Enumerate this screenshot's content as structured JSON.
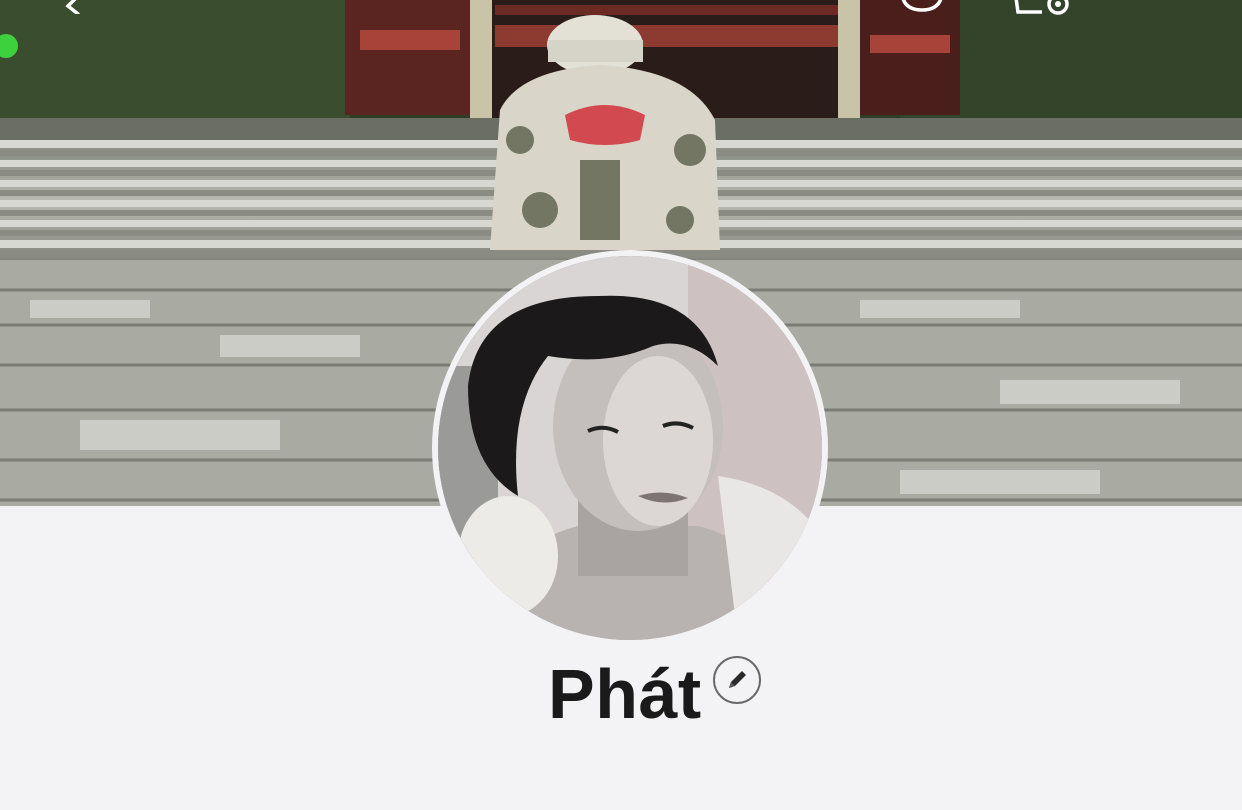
{
  "profile": {
    "name": "Phát",
    "cover_image": "cover-photo",
    "avatar_image": "profile-photo"
  },
  "icons": {
    "back": "back-chevron-icon",
    "chat": "chat-bubble-icon",
    "user_settings": "user-settings-icon",
    "edit": "pencil-edit-icon"
  },
  "colors": {
    "background": "#f3f3f5",
    "name_text": "#1a1a1a",
    "status_dot": "#3ed13e"
  }
}
